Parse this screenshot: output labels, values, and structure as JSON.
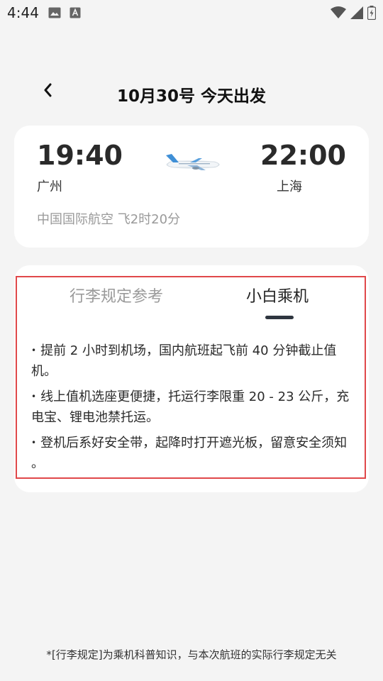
{
  "status_bar": {
    "time": "4:44"
  },
  "header": {
    "title": "10月30号 今天出发"
  },
  "flight": {
    "departure_time": "19:40",
    "arrival_time": "22:00",
    "departure_city": "广州",
    "arrival_city": "上海",
    "airline_duration": "中国国际航空 飞2时20分"
  },
  "tabs": [
    {
      "label": "行李规定参考"
    },
    {
      "label": "小白乘机"
    }
  ],
  "tips": [
    "提前 2 小时到机场，国内航班起飞前 40 分钟截止值机。",
    "线上值机选座更便捷，托运行李限重 20 - 23 公斤，充电宝、锂电池禁托运。",
    "登机后系好安全带，起降时打开遮光板，留意安全须知 。"
  ],
  "footnote": "*[行李规定]为乘机科普知识，与本次航班的实际行李规定无关",
  "colors": {
    "accent": "#2f3640",
    "highlight_border": "#e0484a",
    "muted_text": "#9a9a9a"
  }
}
